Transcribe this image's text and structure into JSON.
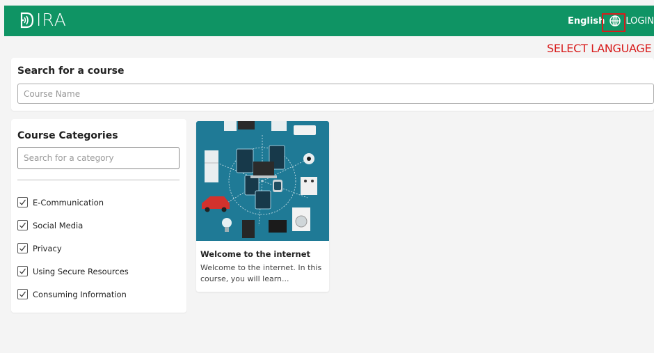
{
  "header": {
    "logo_text": "IRA",
    "language_label": "English",
    "login_label": "LOGIN"
  },
  "annotation": {
    "select_language": "SELECT LANGUAGE"
  },
  "search": {
    "title": "Search for a course",
    "placeholder": "Course Name"
  },
  "categories": {
    "title": "Course Categories",
    "placeholder": "Search for a category",
    "items": [
      {
        "label": "E-Communication",
        "checked": true
      },
      {
        "label": "Social Media",
        "checked": true
      },
      {
        "label": "Privacy",
        "checked": true
      },
      {
        "label": "Using Secure Resources",
        "checked": true
      },
      {
        "label": "Consuming Information",
        "checked": true
      }
    ]
  },
  "courses": [
    {
      "title": "Welcome to the internet",
      "description": "Welcome to the internet. In this course, you will learn..."
    }
  ],
  "colors": {
    "brand": "#0f9464",
    "highlight": "#d81c1c",
    "card_image_bg": "#1f7a96"
  }
}
